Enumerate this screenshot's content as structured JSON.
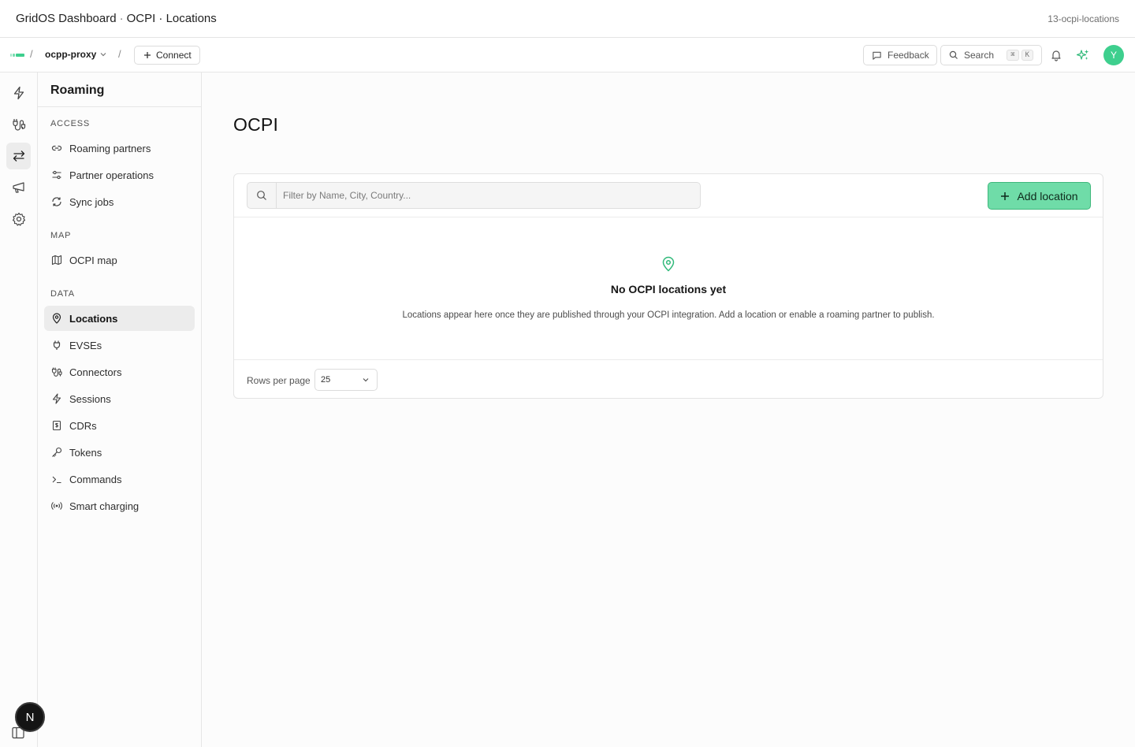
{
  "titlebar": {
    "app_name": "GridOS Dashboard",
    "separator": "·",
    "section": "OCPI · Locations",
    "slug": "13-ocpi-locations"
  },
  "topnav": {
    "divider": "/",
    "project": "ocpp-proxy",
    "connect_label": "Connect",
    "feedback_label": "Feedback",
    "search_label": "Search",
    "search_shortcut": [
      "⌘",
      "K"
    ],
    "avatar_initial": "Y",
    "accent_color": "#3ecf8e"
  },
  "rail": {
    "items": [
      {
        "icon": "bolt-icon"
      },
      {
        "icon": "plug-icon"
      },
      {
        "icon": "arrows-swap-icon",
        "active": true
      },
      {
        "icon": "megaphone-icon"
      },
      {
        "icon": "gear-icon"
      }
    ],
    "badge": "N"
  },
  "sidemenu": {
    "title": "Roaming",
    "sections": [
      {
        "title": "ACCESS",
        "items": [
          {
            "label": "Roaming partners",
            "icon": "link-icon"
          },
          {
            "label": "Partner operations",
            "icon": "settings-sliders-icon"
          },
          {
            "label": "Sync jobs",
            "icon": "refresh-icon"
          }
        ]
      },
      {
        "title": "MAP",
        "items": [
          {
            "label": "OCPI map",
            "icon": "map-icon"
          }
        ]
      },
      {
        "title": "DATA",
        "items": [
          {
            "label": "Locations",
            "icon": "map-pin-icon",
            "active": true
          },
          {
            "label": "EVSEs",
            "icon": "plug-icon"
          },
          {
            "label": "Connectors",
            "icon": "cable-icon"
          },
          {
            "label": "Sessions",
            "icon": "bolt-icon"
          },
          {
            "label": "CDRs",
            "icon": "receipt-icon"
          },
          {
            "label": "Tokens",
            "icon": "key-icon"
          },
          {
            "label": "Commands",
            "icon": "terminal-icon"
          },
          {
            "label": "Smart charging",
            "icon": "signal-icon"
          }
        ]
      }
    ]
  },
  "main": {
    "page_title": "OCPI",
    "filter_placeholder": "Filter by Name, City, Country...",
    "add_button": "Add location",
    "empty_title": "No OCPI locations yet",
    "empty_description": "Locations appear here once they are published through your OCPI integration. Add a location or enable a roaming partner to publish.",
    "rows_label": "Rows per page",
    "rows_value": "25"
  }
}
